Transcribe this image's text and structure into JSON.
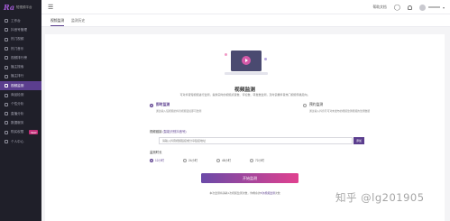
{
  "app": {
    "logo_mark": "Ra",
    "logo_sub": "短视频平台"
  },
  "sidebar": {
    "items": [
      {
        "label": "工作台",
        "icon": "dashboard-icon"
      },
      {
        "label": "抖音号管理",
        "icon": "account-icon"
      },
      {
        "label": "热门视频",
        "icon": "fire-icon"
      },
      {
        "label": "热门音乐",
        "icon": "music-icon"
      },
      {
        "label": "视频排行榜",
        "icon": "rank-icon"
      },
      {
        "label": "播主搜索",
        "icon": "search-icon"
      },
      {
        "label": "播主排行",
        "icon": "trophy-icon"
      },
      {
        "label": "视频监测",
        "icon": "monitor-icon",
        "active": true
      },
      {
        "label": "商品检测",
        "icon": "goods-icon"
      },
      {
        "label": "个性分析",
        "icon": "analysis-icon"
      },
      {
        "label": "直播分析",
        "icon": "live-icon"
      },
      {
        "label": "数据服务",
        "icon": "data-icon"
      },
      {
        "label": "购买权限",
        "icon": "cart-icon",
        "badge": "NEW"
      },
      {
        "label": "个人中心",
        "icon": "user-icon"
      }
    ]
  },
  "topbar": {
    "menu_icon": "☰",
    "help_label": "帮助文档",
    "headset_icon": "headset-icon"
  },
  "tabs": [
    {
      "label": "视频监测",
      "active": true
    },
    {
      "label": "监测历史",
      "active": false
    }
  ],
  "main": {
    "title": "视频监测",
    "description": "可对抖音短视频进行监测，提供实时的视频点赞数、评论数、转发数监测，及时掌握抖音热门视频传播走向。",
    "modes": [
      {
        "label": "即时监测",
        "note": "通过输入短视频的抖音视频链接即可监测",
        "selected": true
      },
      {
        "label": "预约监测",
        "note": "通过输入抖音号可对未发布的视频监测视频的监测数据",
        "selected": false
      }
    ],
    "link_label": "视频链接",
    "link_hint": "(智能识别抖音号)",
    "link_placeholder": "请输入抖音视频链接或分享链接地址",
    "add_button": "添加",
    "duration_label": "监测时长",
    "durations": [
      {
        "label": "12小时",
        "selected": true
      },
      {
        "label": "24小时",
        "selected": false
      },
      {
        "label": "48小时",
        "selected": false
      },
      {
        "label": "72小时",
        "selected": false
      }
    ],
    "start_button": "开始监测",
    "footnote_pre": "本次监测将消耗1次视频监测次数，你剩余的",
    "footnote_link": "5次视频监测",
    "footnote_post": "次数"
  },
  "watermark": "知乎 @lg201905",
  "colors": {
    "sidebar_bg": "#1f1f29",
    "accent": "#5b3e8e",
    "gradient_start": "#6b4aa8",
    "gradient_end": "#e0418f"
  }
}
